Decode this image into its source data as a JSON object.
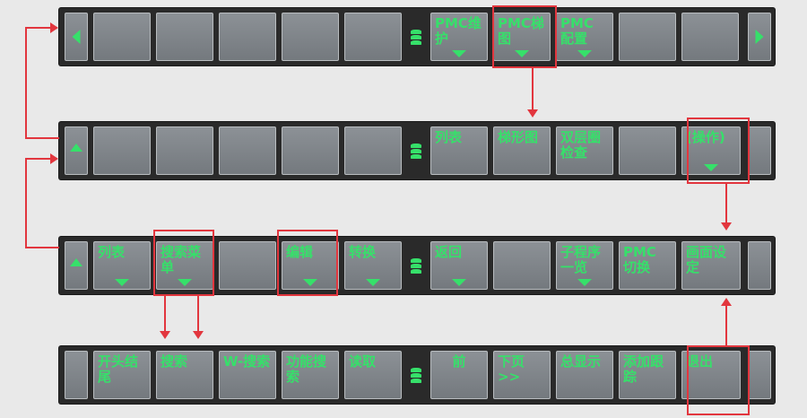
{
  "colors": {
    "label": "#36e06a",
    "highlight": "#e2363e",
    "bar": "#2a2a2a",
    "key": "#83888d"
  },
  "row1": {
    "nav_left_icon": "arrow-left-icon",
    "nav_right_icon": "arrow-right-icon",
    "separator_icon": "layers-icon",
    "keys": [
      "",
      "",
      "",
      "",
      "",
      "PMC维护",
      "PMC梯图",
      "PMC 配置",
      "",
      ""
    ]
  },
  "row2": {
    "nav_up_icon": "arrow-up-icon",
    "keys": [
      "",
      "",
      "",
      "",
      "",
      "列表",
      "梯形图",
      "双层圈检查",
      "",
      "(操作)"
    ]
  },
  "row3": {
    "nav_up_icon": "arrow-up-icon",
    "keys": [
      "列表",
      "搜索菜单",
      "",
      "编辑",
      "转换",
      "返回",
      "",
      "子程序一览",
      "PMC 切换",
      "画面设定"
    ]
  },
  "row4": {
    "keys": [
      "开头结尾",
      "搜索",
      "W-搜索",
      "功能搜索",
      "读取",
      "前",
      "下页>>",
      "总显示",
      "添加跟踪",
      "退出"
    ]
  }
}
